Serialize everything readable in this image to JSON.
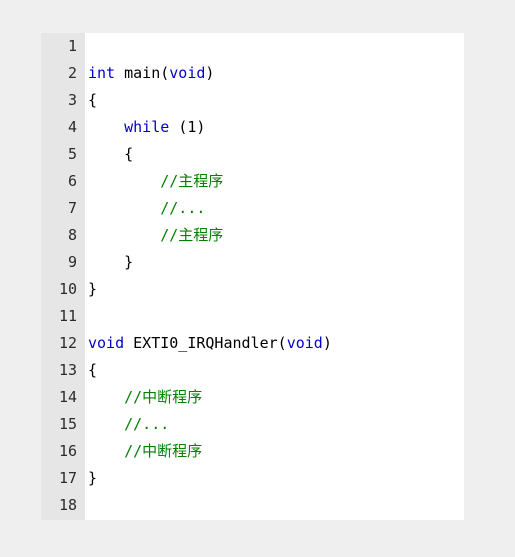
{
  "editor": {
    "name": "code-viewer",
    "language": "c",
    "background_color": "#ffffff",
    "page_background_color": "#efefef",
    "gutter_background_color": "#e6e6e6",
    "line_number_color": "#2b2b2b",
    "total_lines": 18,
    "syntax_colors": {
      "keyword": "#0000cd",
      "comment": "#008000",
      "identifier": "#000000",
      "punctuation": "#000000",
      "number": "#000000"
    }
  },
  "lines": [
    {
      "number": "1",
      "text": "",
      "tokens": []
    },
    {
      "number": "2",
      "text": "int main(void)",
      "tokens": [
        {
          "t": "int",
          "k": "kw"
        },
        {
          "t": " ",
          "k": "plain"
        },
        {
          "t": "main",
          "k": "plain"
        },
        {
          "t": "(",
          "k": "punct"
        },
        {
          "t": "void",
          "k": "kw"
        },
        {
          "t": ")",
          "k": "punct"
        }
      ]
    },
    {
      "number": "3",
      "text": "{",
      "tokens": [
        {
          "t": "{",
          "k": "punct"
        }
      ]
    },
    {
      "number": "4",
      "text": "    while (1)",
      "tokens": [
        {
          "t": "    ",
          "k": "plain"
        },
        {
          "t": "while",
          "k": "kw"
        },
        {
          "t": " ",
          "k": "plain"
        },
        {
          "t": "(",
          "k": "punct"
        },
        {
          "t": "1",
          "k": "num"
        },
        {
          "t": ")",
          "k": "punct"
        }
      ]
    },
    {
      "number": "5",
      "text": "    {",
      "tokens": [
        {
          "t": "    ",
          "k": "plain"
        },
        {
          "t": "{",
          "k": "punct"
        }
      ]
    },
    {
      "number": "6",
      "text": "        //主程序",
      "tokens": [
        {
          "t": "        ",
          "k": "plain"
        },
        {
          "t": "//主程序",
          "k": "comment"
        }
      ]
    },
    {
      "number": "7",
      "text": "        //...",
      "tokens": [
        {
          "t": "        ",
          "k": "plain"
        },
        {
          "t": "//...",
          "k": "comment"
        }
      ]
    },
    {
      "number": "8",
      "text": "        //主程序",
      "tokens": [
        {
          "t": "        ",
          "k": "plain"
        },
        {
          "t": "//主程序",
          "k": "comment"
        }
      ]
    },
    {
      "number": "9",
      "text": "    }",
      "tokens": [
        {
          "t": "    ",
          "k": "plain"
        },
        {
          "t": "}",
          "k": "punct"
        }
      ]
    },
    {
      "number": "10",
      "text": "}",
      "tokens": [
        {
          "t": "}",
          "k": "punct"
        }
      ]
    },
    {
      "number": "11",
      "text": "",
      "tokens": []
    },
    {
      "number": "12",
      "text": "void EXTI0_IRQHandler(void)",
      "tokens": [
        {
          "t": "void",
          "k": "kw"
        },
        {
          "t": " ",
          "k": "plain"
        },
        {
          "t": "EXTI0_IRQHandler",
          "k": "plain"
        },
        {
          "t": "(",
          "k": "punct"
        },
        {
          "t": "void",
          "k": "kw"
        },
        {
          "t": ")",
          "k": "punct"
        }
      ]
    },
    {
      "number": "13",
      "text": "{",
      "tokens": [
        {
          "t": "{",
          "k": "punct"
        }
      ]
    },
    {
      "number": "14",
      "text": "    //中断程序",
      "tokens": [
        {
          "t": "    ",
          "k": "plain"
        },
        {
          "t": "//中断程序",
          "k": "comment"
        }
      ]
    },
    {
      "number": "15",
      "text": "    //...",
      "tokens": [
        {
          "t": "    ",
          "k": "plain"
        },
        {
          "t": "//...",
          "k": "comment"
        }
      ]
    },
    {
      "number": "16",
      "text": "    //中断程序",
      "tokens": [
        {
          "t": "    ",
          "k": "plain"
        },
        {
          "t": "//中断程序",
          "k": "comment"
        }
      ]
    },
    {
      "number": "17",
      "text": "}",
      "tokens": [
        {
          "t": "}",
          "k": "punct"
        }
      ]
    },
    {
      "number": "18",
      "text": "",
      "tokens": []
    }
  ]
}
